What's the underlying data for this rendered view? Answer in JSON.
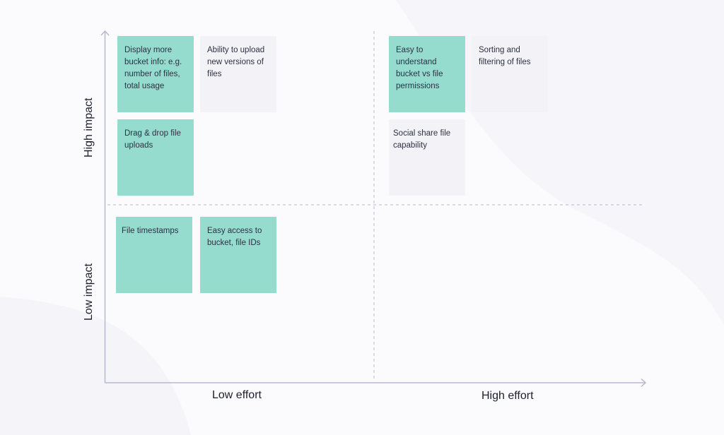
{
  "colors": {
    "high_priority_note": "#95dccf",
    "neutral_note": "#f2f2f7",
    "axis": "#b9b8cf",
    "text": "#2d3142",
    "background": "#fbfbfd"
  },
  "axes": {
    "y_high": "High impact",
    "y_low": "Low impact",
    "x_low": "Low effort",
    "x_high": "High effort"
  },
  "quadrants": {
    "high_impact_low_effort": [
      {
        "text": "Display more bucket info: e.g. number of files, total usage",
        "color": "teal"
      },
      {
        "text": "Ability to upload new versions of files",
        "color": "grey"
      },
      {
        "text": "Drag & drop file uploads",
        "color": "teal"
      }
    ],
    "high_impact_high_effort": [
      {
        "text": "Easy to understand bucket vs file permissions",
        "color": "teal"
      },
      {
        "text": "Sorting and filtering of files",
        "color": "grey"
      },
      {
        "text": "Social share file capability",
        "color": "grey"
      }
    ],
    "low_impact_low_effort": [
      {
        "text": "File timestamps",
        "color": "teal"
      },
      {
        "text": "Easy access to bucket, file IDs",
        "color": "teal"
      }
    ],
    "low_impact_high_effort": []
  }
}
